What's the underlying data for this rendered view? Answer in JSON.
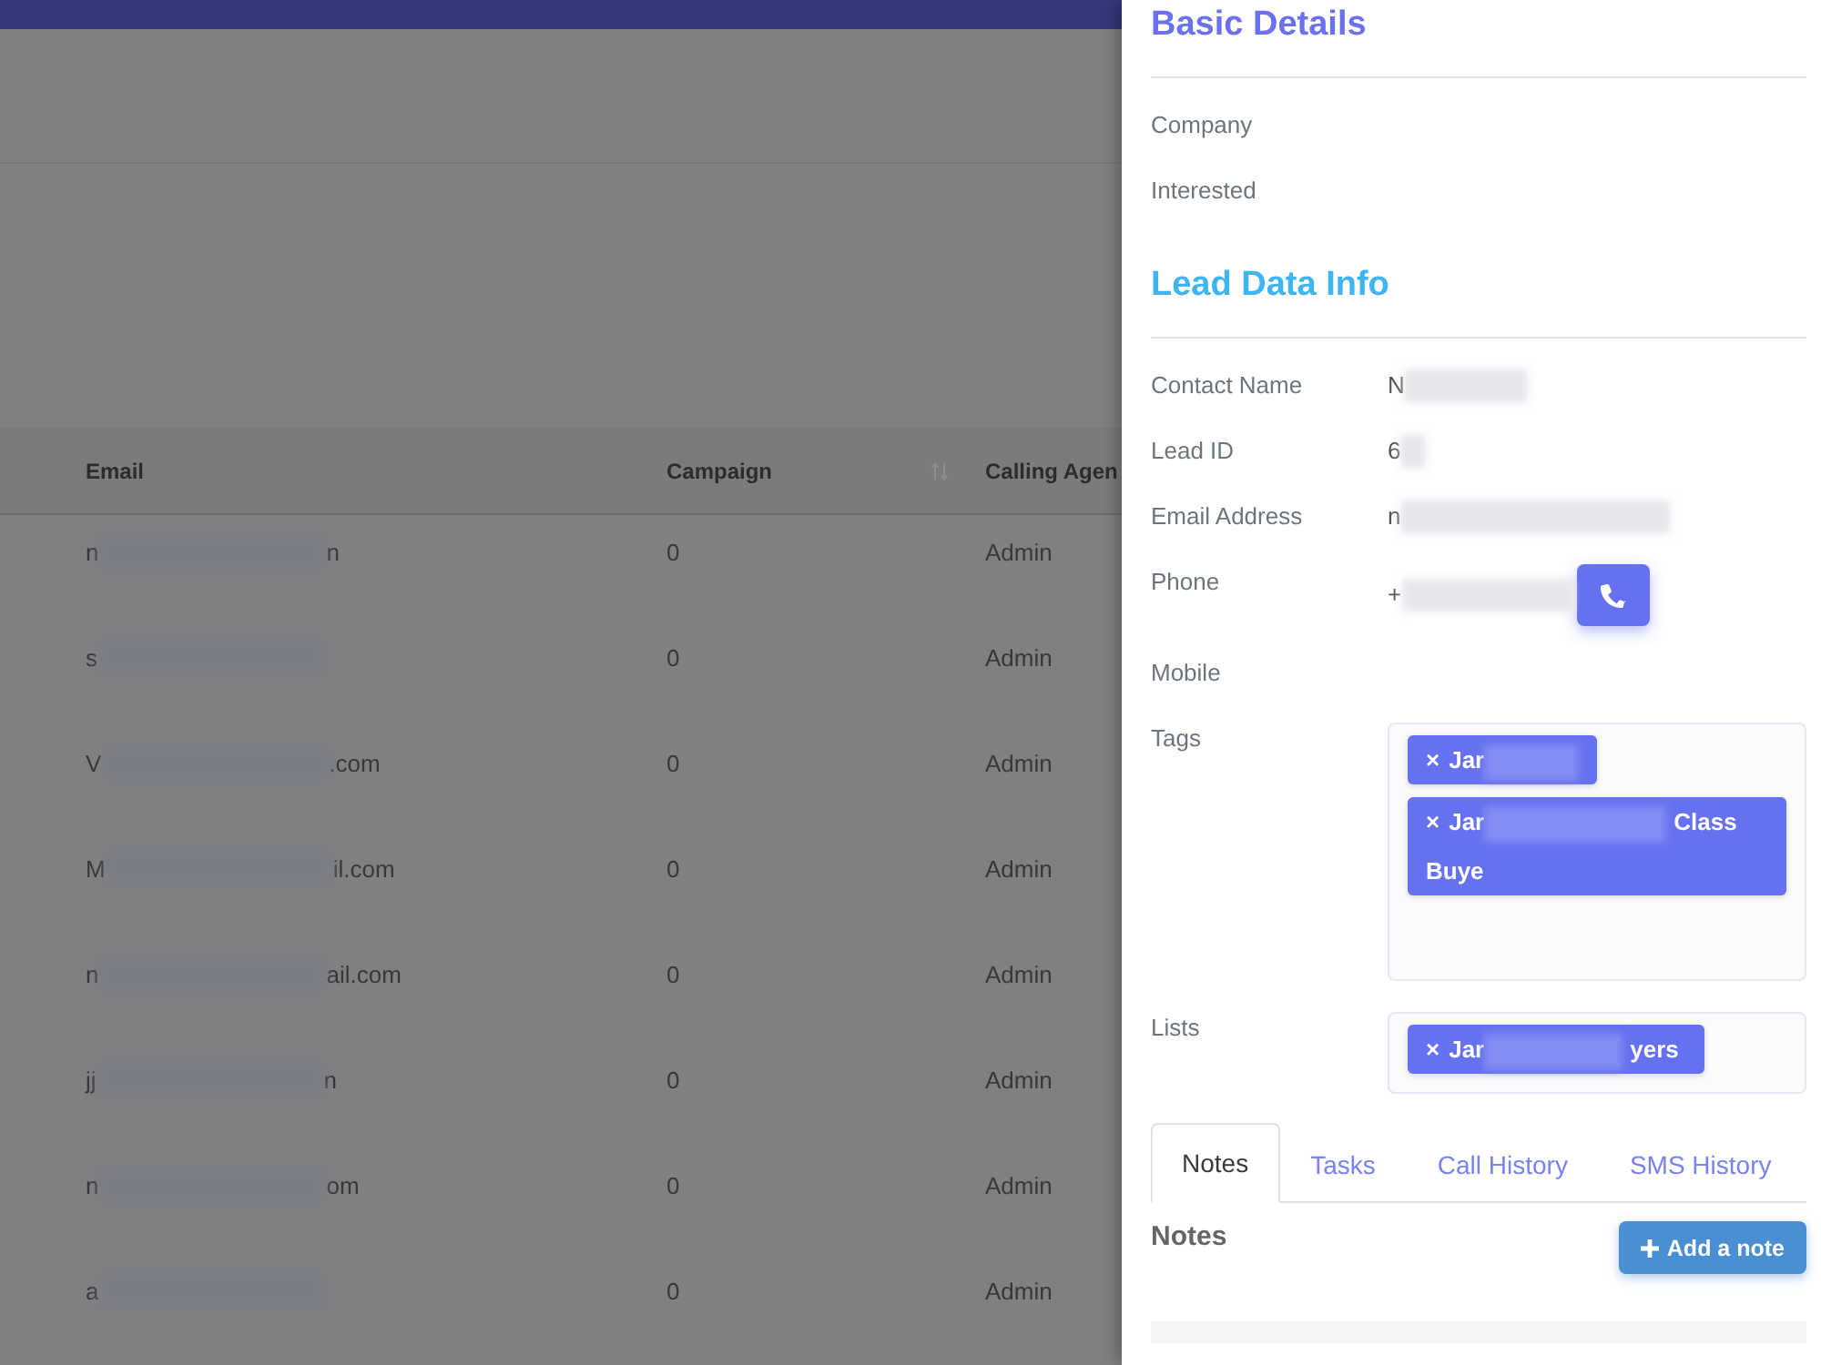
{
  "table": {
    "columns": [
      {
        "label": "Email",
        "sortable": false
      },
      {
        "label": "Campaign",
        "sortable": true
      },
      {
        "label": "Calling Agen",
        "sortable": false
      }
    ],
    "rows": [
      {
        "email": {
          "start": "n",
          "end": "n",
          "redacted": true
        },
        "campaign": "0",
        "calling_agent": "Admin"
      },
      {
        "email": {
          "start": "s",
          "redacted": true
        },
        "campaign": "0",
        "calling_agent": "Admin"
      },
      {
        "email": {
          "start": "V",
          "end": ".com",
          "redacted": true
        },
        "campaign": "0",
        "calling_agent": "Admin"
      },
      {
        "email": {
          "start": "M",
          "end": "il.com",
          "redacted": true
        },
        "campaign": "0",
        "calling_agent": "Admin"
      },
      {
        "email": {
          "start": "n",
          "end": "ail.com",
          "redacted": true
        },
        "campaign": "0",
        "calling_agent": "Admin"
      },
      {
        "email": {
          "start": "jj",
          "end": "n",
          "redacted": true
        },
        "campaign": "0",
        "calling_agent": "Admin"
      },
      {
        "email": {
          "start": "n",
          "end": "om",
          "redacted": true
        },
        "campaign": "0",
        "calling_agent": "Admin"
      },
      {
        "email": {
          "start": "a",
          "redacted": true
        },
        "campaign": "0",
        "calling_agent": "Admin"
      }
    ]
  },
  "panel": {
    "sections": [
      {
        "title": "Basic Details",
        "color": "#6b72ef",
        "fields": [
          {
            "kind": "text",
            "label": "Company"
          },
          {
            "kind": "text",
            "label": "Interested"
          }
        ]
      },
      {
        "title": "Lead Data Info",
        "color": "#3db5f2",
        "fields": [
          {
            "kind": "text",
            "label": "Contact Name",
            "value": "N",
            "redacted": true
          },
          {
            "kind": "text",
            "label": "Lead ID",
            "value": "6",
            "redacted": true
          },
          {
            "kind": "text",
            "label": "Email Address",
            "value": "n",
            "redacted": true
          },
          {
            "kind": "phone",
            "label": "Phone",
            "value": "+",
            "redacted": true
          },
          {
            "kind": "text",
            "label": "Mobile"
          },
          {
            "kind": "chips",
            "label": "Tags",
            "chips": [
              {
                "remove": "×",
                "start": "Jar",
                "redacted": true
              },
              {
                "remove": "×",
                "start": "Jar",
                "end": [
                  "Class",
                  "Buye"
                ],
                "redacted": true
              }
            ]
          },
          {
            "kind": "chips",
            "label": "Lists",
            "chips": [
              {
                "remove": "×",
                "start": "Jar",
                "end": [
                  "yers"
                ],
                "redacted": true
              }
            ]
          }
        ]
      }
    ],
    "tabs": [
      {
        "label": "Notes",
        "selected": true
      },
      {
        "label": "Tasks",
        "selected": false
      },
      {
        "label": "Call History",
        "selected": false
      },
      {
        "label": "SMS History",
        "selected": false
      }
    ],
    "notes": {
      "title": "Notes",
      "add_button": "Add a note"
    }
  }
}
